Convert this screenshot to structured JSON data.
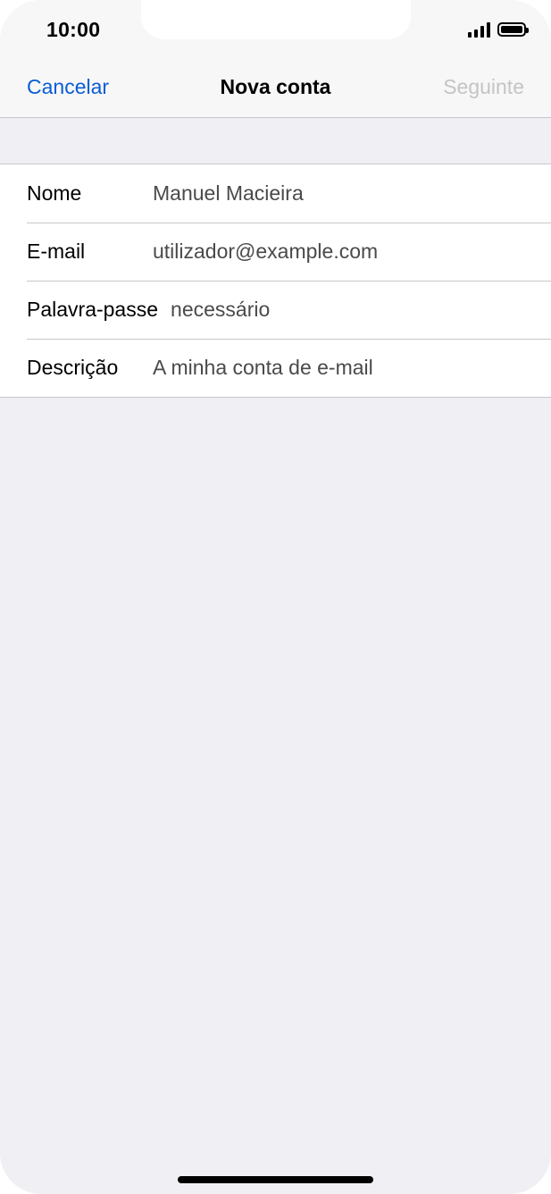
{
  "status_bar": {
    "time": "10:00",
    "icons": [
      "signal-icon",
      "battery-icon"
    ]
  },
  "nav": {
    "cancel_label": "Cancelar",
    "title": "Nova conta",
    "next_label": "Seguinte"
  },
  "form": {
    "fields": [
      {
        "label": "Nome",
        "value": "Manuel Macieira"
      },
      {
        "label": "E-mail",
        "value": "utilizador@example.com"
      },
      {
        "label": "Palavra-passe",
        "value": "necessário"
      },
      {
        "label": "Descrição",
        "value": "A minha conta de e-mail"
      }
    ]
  },
  "colors": {
    "accent": "#0a5cd6",
    "disabled": "#c4c4c6",
    "background": "#efeff4"
  }
}
